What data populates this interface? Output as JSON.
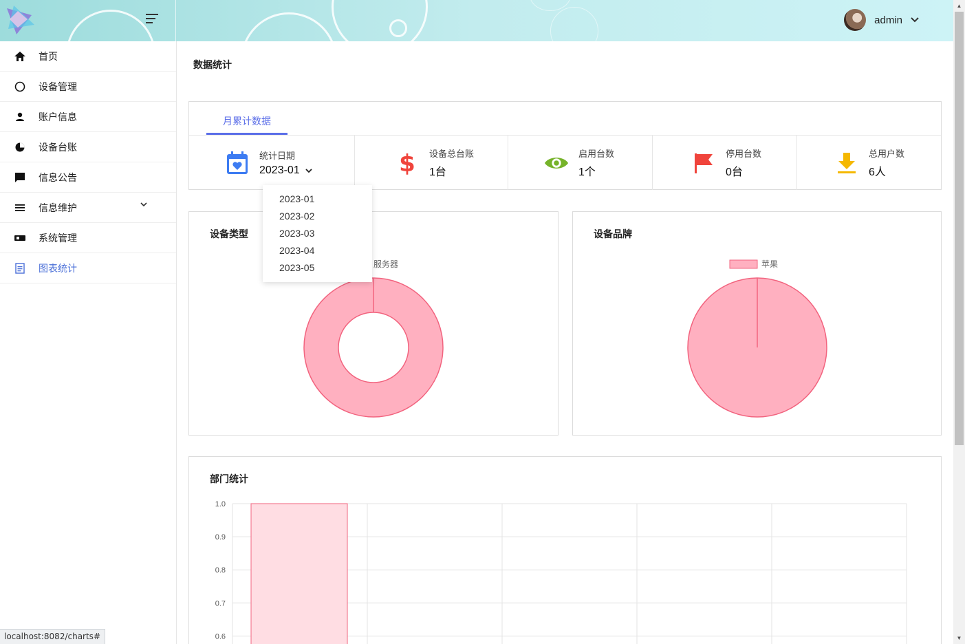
{
  "header": {
    "username": "admin",
    "icons": {
      "logo": "logo",
      "menu": "menu-toggle-icon",
      "dropdown": "chevron-down-icon"
    }
  },
  "sidebar": {
    "items": [
      {
        "label": "首页",
        "icon": "home-icon"
      },
      {
        "label": "设备管理",
        "icon": "circle-icon"
      },
      {
        "label": "账户信息",
        "icon": "person-icon"
      },
      {
        "label": "设备台账",
        "icon": "pie-icon"
      },
      {
        "label": "信息公告",
        "icon": "chat-icon"
      },
      {
        "label": "信息维护",
        "icon": "list-icon",
        "expandable": true
      },
      {
        "label": "系统管理",
        "icon": "toggle-icon"
      },
      {
        "label": "图表统计",
        "icon": "document-icon",
        "active": true
      }
    ]
  },
  "main": {
    "page_title": "数据统计",
    "tab": "月累计数据",
    "stats": {
      "date_label": "统计日期",
      "date_value": "2023-01",
      "total_label": "设备总台账",
      "total_value": "1台",
      "active_label": "启用台数",
      "active_value": "1个",
      "stopped_label": "停用台数",
      "stopped_value": "0台",
      "users_label": "总用户数",
      "users_value": "6人"
    },
    "date_options": [
      "2023-01",
      "2023-02",
      "2023-03",
      "2023-04",
      "2023-05"
    ],
    "device_type_title": "设备类型",
    "device_brand_title": "设备品牌",
    "department_title": "部门统计"
  },
  "colors": {
    "accent": "#5b6ee8",
    "pie_fill": "#ffb0c0",
    "pie_stroke": "#f2647f",
    "bar_fill": "#ffdde3",
    "bar_stroke": "#f2647f"
  },
  "chart_data": [
    {
      "type": "pie",
      "variant": "donut",
      "title": "设备类型",
      "legend": [
        "服务器"
      ],
      "series": [
        {
          "name": "服务器",
          "values": [
            1
          ]
        }
      ]
    },
    {
      "type": "pie",
      "title": "设备品牌",
      "legend": [
        "苹果"
      ],
      "series": [
        {
          "name": "苹果",
          "values": [
            1
          ]
        }
      ]
    },
    {
      "type": "bar",
      "title": "部门统计",
      "yticks": [
        "1.0",
        "0.9",
        "0.8",
        "0.7",
        "0.6"
      ],
      "ytick_values": [
        1.0,
        0.9,
        0.8,
        0.7,
        0.6
      ],
      "ylim_visible": [
        0.6,
        1.0
      ],
      "categories_count": 5,
      "values": [
        1
      ]
    }
  ],
  "statusbar": {
    "url": "localhost:8082/charts#"
  }
}
